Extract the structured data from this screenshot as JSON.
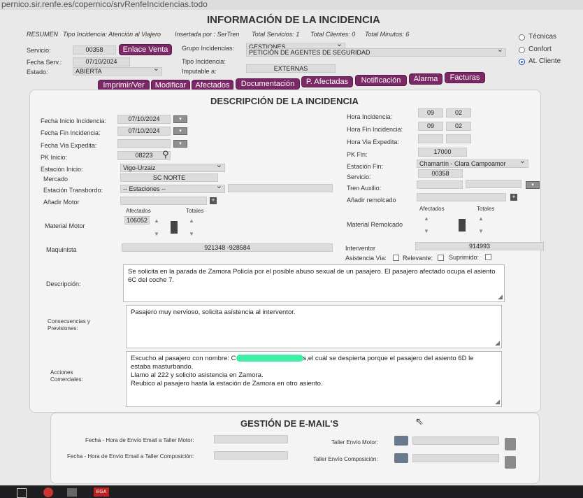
{
  "browser": {
    "url": "pernico.sir.renfe.es/copernico/srvRenfeIncidencias.todo"
  },
  "header": {
    "title": "INFORMACIÓN DE LA INCIDENCIA"
  },
  "summary": {
    "resumen": "RESUMEN",
    "tipo": "Tipo Incidencia: Atención al Viajero",
    "insertada": "Insertada por : SerTren",
    "servicios": "Total Servicios: 1",
    "clientes": "Total Clientes: 0",
    "minutos": "Total Minutos: 6"
  },
  "top": {
    "servicio_label": "Servicio:",
    "servicio": "00358",
    "enlace_venta": "Enlace Venta",
    "fecha_serv_label": "Fecha Serv.:",
    "fecha_serv": "07/10/2024",
    "estado_label": "Estado:",
    "estado": "ABIERTA",
    "grupo_label": "Grupo Incidencias:",
    "grupo": "GESTIONES",
    "tipo_label": "Tipo Incidencia:",
    "tipo": "PETICIÓN DE AGENTES DE SEGURIDAD",
    "imputable_label": "Imputable a:",
    "imputable": "EXTERNAS"
  },
  "radios": [
    {
      "label": "Técnicas",
      "selected": false
    },
    {
      "label": "Confort",
      "selected": false
    },
    {
      "label": "At. Cliente",
      "selected": true
    }
  ],
  "buttons": [
    "Imprimir/Ver",
    "Modificar",
    "Afectados",
    "Documentación",
    "P. Afectadas",
    "Notificación",
    "Alarma",
    "Facturas"
  ],
  "desc": {
    "title": "DESCRIPCIÓN DE LA INCIDENCIA",
    "fecha_inicio_label": "Fecha Inicio Incidencia:",
    "fecha_inicio": "07/10/2024",
    "fecha_fin_label": "Fecha Fin Incidencia:",
    "fecha_fin": "07/10/2024",
    "fecha_via_label": "Fecha Via Expedita:",
    "hora_inc_label": "Hora Incidencia:",
    "hora_inc_h": "09",
    "hora_inc_m": "02",
    "hora_fin_label": "Hora Fin Incidencia:",
    "hora_fin_h": "09",
    "hora_fin_m": "02",
    "hora_via_label": "Hora Via Expedita:",
    "pk_inicio_label": "PK Inicio:",
    "pk_inicio": "08223",
    "pk_fin_label": "PK Fin:",
    "pk_fin": "17000",
    "est_inicio_label": "Estación Inicio:",
    "est_inicio": "Vigo-Urzaiz",
    "est_fin_label": "Estación Fin:",
    "est_fin": "Chamartín - Clara Campoamor",
    "mercado_label": "Mercado",
    "mercado": "SC NORTE",
    "servicio_label": "Servicio:",
    "servicio": "00358",
    "transbordo_label": "Estación Transbordo:",
    "transbordo": "-- Estaciones --",
    "tren_aux_label": "Tren Auxilio:",
    "anadir_motor_label": "Añadir Motor",
    "anadir_remolcado_label": "Añadir remolcado",
    "afectados": "Afectados",
    "totales": "Totales",
    "material_motor_label": "Material Motor",
    "material_motor": "106052",
    "material_remolcado_label": "Material Remolcado",
    "maquinista_label": "Maquinista",
    "maquinista": "921348 -928584",
    "interventor_label": "Interventor",
    "interventor": "914993",
    "asistencia_label": "Asistencia Via:",
    "relevante_label": "Relevante:",
    "suprimido_label": "Suprimido:",
    "descripcion_label": "Descripción:",
    "descripcion": "Se solicita en la parada de Zamora Policía por el posible abuso sexual de un pasajero. El pasajero afectado ocupa el asiento 6C del coche 7.",
    "consecuencias_label": "Consecuencias y Previsiones:",
    "consecuencias": "Pasajero muy nervioso, solicita asistencia al interventor.",
    "acciones_label": "Acciones Comerciales:",
    "acciones_line1a": "Escucho al pasajero con nombre: C",
    "acciones_line1b": "s,el cuál se despierta porque el pasajero del asiento 6D le",
    "acciones_line2": "estaba masturbando.",
    "acciones_line3": "Llamo al 222 y solicito asistencia en Zamora.",
    "acciones_line4": "Reubico al pasajero hasta la estación de Zamora en otro asiento."
  },
  "email": {
    "title": "GESTIÓN DE E-MAIL'S",
    "motor_label": "Fecha - Hora de Envío Email a Taller Motor:",
    "comp_label": "Fecha - Hora de Envío Email a Taller Composición:",
    "taller_motor_label": "Taller Envío Motor:",
    "taller_comp_label": "Taller Envío Composición:"
  },
  "colors": {
    "button_bg": "#7b2866",
    "panel_bg": "#f4f4f5",
    "redaction": "#3ef0a6"
  }
}
